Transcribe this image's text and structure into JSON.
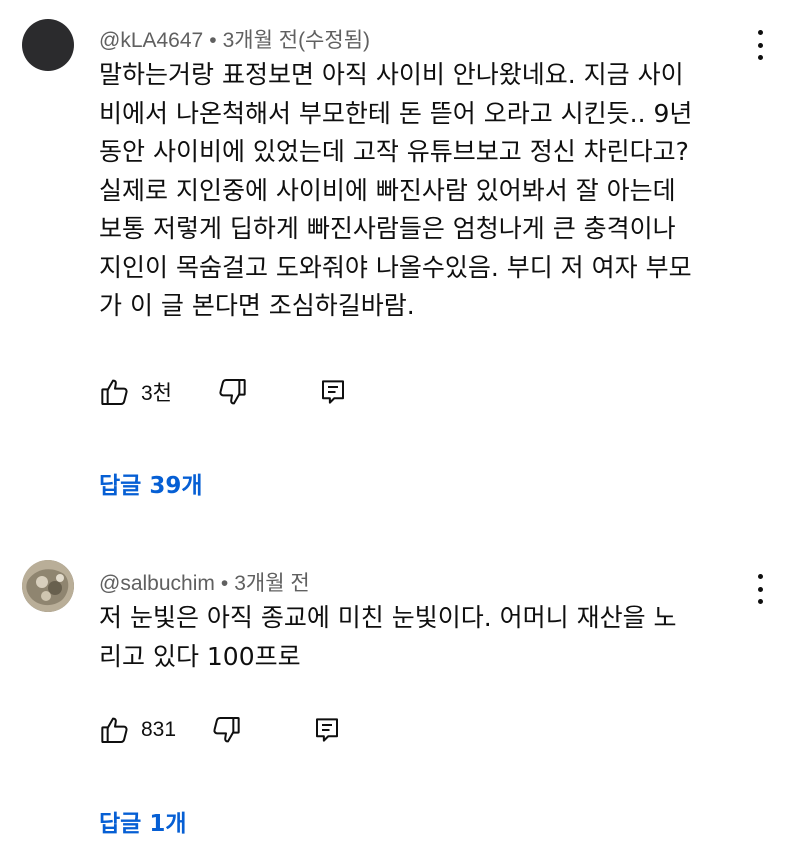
{
  "comments": [
    {
      "author": "@kLA4647",
      "time": "3개월 전(수정됨)",
      "lines": [
        "말하는거랑 표정보면 아직 사이비 안나왔네요.  지금 사이",
        "비에서 나온척해서 부모한테 돈 뜯어 오라고 시킨듯.. 9년",
        "동안 사이비에 있었는데 고작 유튜브보고 정신 차린다고?",
        "실제로 지인중에 사이비에 빠진사람 있어봐서 잘 아는데",
        "보통 저렇게 딥하게 빠진사람들은 엄청나게 큰 충격이나",
        "지인이 목숨걸고 도와줘야 나올수있음. 부디 저 여자 부모",
        "가 이 글 본다면 조심하길바람."
      ],
      "likes": "3천",
      "replies": "답글 39개",
      "avatar": "dark-avatar"
    },
    {
      "author": "@salbuchim",
      "time": "3개월 전",
      "lines": [
        "저 눈빛은  아직 종교에 미친 눈빛이다. 어머니 재산을 노",
        "리고 있다 100프로"
      ],
      "likes": "831",
      "replies": "답글 1개",
      "avatar": "photo-avatar"
    }
  ],
  "icons": {
    "like": "thumbs-up-icon",
    "dislike": "thumbs-down-icon",
    "reply": "reply-comment-icon",
    "more": "more-vertical-icon"
  },
  "colors": {
    "text": "#0f0f0f",
    "meta": "#606060",
    "replies_link": "#065fd4"
  }
}
